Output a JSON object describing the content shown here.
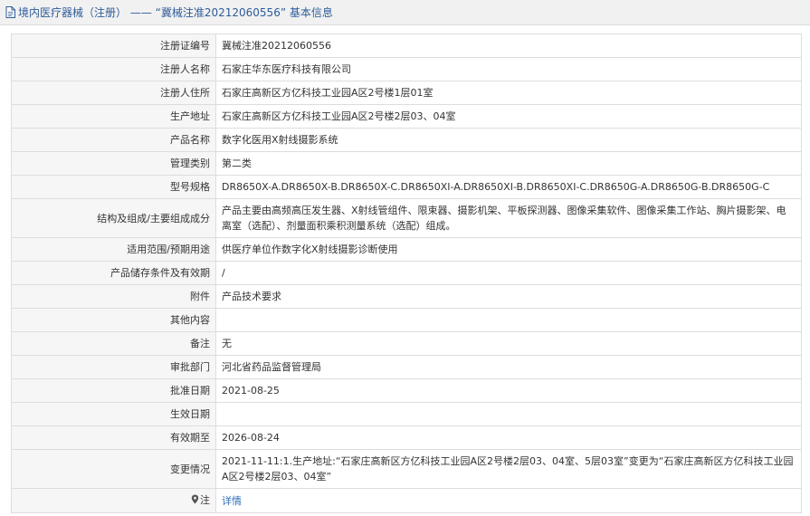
{
  "header": {
    "title": "境内医疗器械（注册） —— “冀械注准20212060556” 基本信息"
  },
  "rows": [
    {
      "key": "注册证编号",
      "value": "冀械注准20212060556"
    },
    {
      "key": "注册人名称",
      "value": "石家庄华东医疗科技有限公司"
    },
    {
      "key": "注册人住所",
      "value": "石家庄高新区方亿科技工业园A区2号楼1层01室"
    },
    {
      "key": "生产地址",
      "value": "石家庄高新区方亿科技工业园A区2号楼2层03、04室"
    },
    {
      "key": "产品名称",
      "value": "数字化医用X射线摄影系统"
    },
    {
      "key": "管理类别",
      "value": "第二类"
    },
    {
      "key": "型号规格",
      "value": "DR8650X-A.DR8650X-B.DR8650X-C.DR8650XI-A.DR8650XI-B.DR8650XI-C.DR8650G-A.DR8650G-B.DR8650G-C"
    },
    {
      "key": "结构及组成/主要组成成分",
      "value": "产品主要由高频高压发生器、X射线管组件、限束器、摄影机架、平板探测器、图像采集软件、图像采集工作站、胸片摄影架、电离室（选配）、剂量面积乘积测量系统（选配）组成。"
    },
    {
      "key": "适用范围/预期用途",
      "value": "供医疗单位作数字化X射线摄影诊断使用"
    },
    {
      "key": "产品储存条件及有效期",
      "value": "/"
    },
    {
      "key": "附件",
      "value": "产品技术要求"
    },
    {
      "key": "其他内容",
      "value": ""
    },
    {
      "key": "备注",
      "value": "无"
    },
    {
      "key": "审批部门",
      "value": "河北省药品监督管理局"
    },
    {
      "key": "批准日期",
      "value": "2021-08-25"
    },
    {
      "key": "生效日期",
      "value": ""
    },
    {
      "key": "有效期至",
      "value": "2026-08-24"
    },
    {
      "key": "变更情况",
      "value": "2021-11-11:1.生产地址:“石家庄高新区方亿科技工业园A区2号楼2层03、04室、5层03室”变更为“石家庄高新区方亿科技工业园A区2号楼2层03、04室”"
    }
  ],
  "note": {
    "key": "注",
    "icon": "pin-icon",
    "link_label": "详情"
  },
  "colors": {
    "header_bg": "#f1f1f1",
    "title": "#2e5c9a",
    "key_bg": "#f6f6f6",
    "border": "#dddddd",
    "link": "#2e6eb8"
  }
}
